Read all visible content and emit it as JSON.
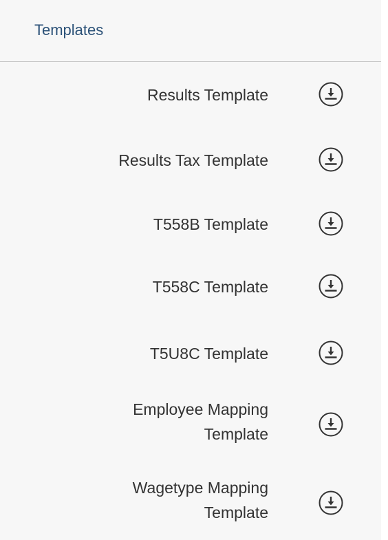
{
  "panel": {
    "title": "Templates"
  },
  "templates": [
    {
      "label": "Results Template",
      "icon": "download-icon"
    },
    {
      "label": "Results Tax Template",
      "icon": "download-icon"
    },
    {
      "label": "T558B Template",
      "icon": "download-icon"
    },
    {
      "label": "T558C Template",
      "icon": "download-icon"
    },
    {
      "label": "T5U8C Template",
      "icon": "download-icon"
    },
    {
      "label": "Employee Mapping\nTemplate",
      "icon": "download-icon"
    },
    {
      "label": "Wagetype Mapping\nTemplate",
      "icon": "download-icon"
    }
  ],
  "colors": {
    "title": "#2c5278",
    "text": "#333333",
    "icon": "#333333",
    "background": "#f7f7f7",
    "divider": "#c8c8c8"
  }
}
